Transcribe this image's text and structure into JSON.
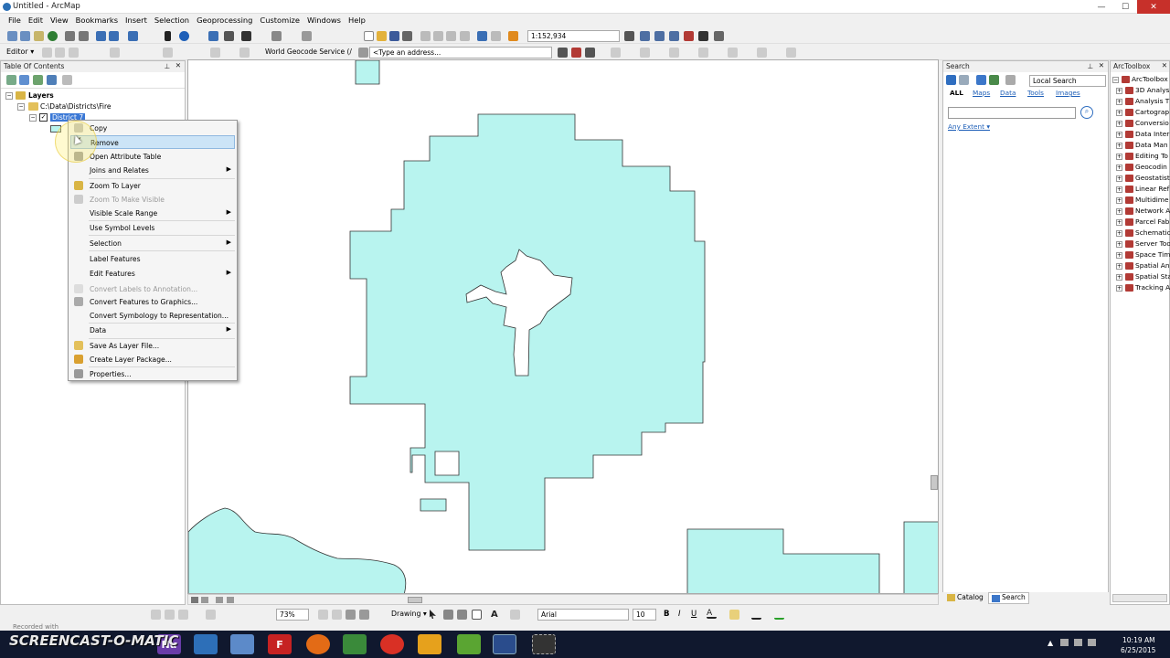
{
  "window": {
    "title": "Untitled - ArcMap",
    "minimize": "—",
    "maximize": "☐",
    "close": "✕"
  },
  "menu": [
    "File",
    "Edit",
    "View",
    "Bookmarks",
    "Insert",
    "Selection",
    "Geoprocessing",
    "Customize",
    "Windows",
    "Help"
  ],
  "toolbar": {
    "scale": "1:152,934",
    "editor_label": "Editor ▾",
    "geocode_service": "World Geocode Service (/",
    "address_placeholder": "<Type an address...",
    "font": "Arial",
    "font_size": "10",
    "drawing_label": "Drawing ▾",
    "bold": "B",
    "italic": "I",
    "underline": "U",
    "zoom_percent": "73%"
  },
  "toc": {
    "title": "Table Of Contents",
    "layers_label": "Layers",
    "folder_path": "C:\\Data\\Districts\\Fire",
    "layer_name": "District 7"
  },
  "context_menu": {
    "items": [
      {
        "label": "Copy",
        "enabled": true,
        "submenu": false,
        "icon": "copy-icon"
      },
      {
        "label": "Remove",
        "enabled": true,
        "submenu": false,
        "icon": "remove-icon",
        "highlighted": true
      },
      {
        "label": "Open Attribute Table",
        "enabled": true,
        "submenu": false,
        "icon": "table-icon"
      },
      {
        "label": "Joins and Relates",
        "enabled": true,
        "submenu": true,
        "icon": ""
      },
      {
        "label": "Zoom To Layer",
        "enabled": true,
        "submenu": false,
        "icon": "zoom-layer-icon"
      },
      {
        "label": "Zoom To Make Visible",
        "enabled": false,
        "submenu": false,
        "icon": "zoom-visible-icon"
      },
      {
        "label": "Visible Scale Range",
        "enabled": true,
        "submenu": true,
        "icon": ""
      },
      {
        "label": "Use Symbol Levels",
        "enabled": true,
        "submenu": false,
        "icon": ""
      },
      {
        "label": "Selection",
        "enabled": true,
        "submenu": true,
        "icon": ""
      },
      {
        "label": "Label Features",
        "enabled": true,
        "submenu": false,
        "icon": ""
      },
      {
        "label": "Edit Features",
        "enabled": true,
        "submenu": true,
        "icon": ""
      },
      {
        "label": "Convert Labels to Annotation...",
        "enabled": false,
        "submenu": false,
        "icon": "annotation-icon"
      },
      {
        "label": "Convert Features to Graphics...",
        "enabled": true,
        "submenu": false,
        "icon": "graphics-icon"
      },
      {
        "label": "Convert Symbology to Representation...",
        "enabled": true,
        "submenu": false,
        "icon": ""
      },
      {
        "label": "Data",
        "enabled": true,
        "submenu": true,
        "icon": ""
      },
      {
        "label": "Save As Layer File...",
        "enabled": true,
        "submenu": false,
        "icon": "layer-file-icon"
      },
      {
        "label": "Create Layer Package...",
        "enabled": true,
        "submenu": false,
        "icon": "layer-package-icon"
      },
      {
        "label": "Properties...",
        "enabled": true,
        "submenu": false,
        "icon": "properties-icon"
      }
    ]
  },
  "search": {
    "title": "Search",
    "scope": "Local Search",
    "tabs": [
      "ALL",
      "Maps",
      "Data",
      "Tools",
      "Images"
    ],
    "extent": "Any Extent ▾",
    "input_value": ""
  },
  "arctoolbox": {
    "title": "ArcToolbox",
    "root": "ArcToolbox",
    "items": [
      "3D Analys",
      "Analysis T",
      "Cartograp",
      "Conversio",
      "Data Inter",
      "Data Man",
      "Editing To",
      "Geocodin",
      "Geostatist",
      "Linear Ref",
      "Multidime",
      "Network A",
      "Parcel Fab",
      "Schematic",
      "Server Too",
      "Space Tim",
      "Spatial An",
      "Spatial Sta",
      "Tracking A"
    ]
  },
  "bottom_tabs": {
    "catalog": "Catalog",
    "search": "Search"
  },
  "taskbar": {
    "time": "10:19 AM",
    "date": "6/25/2015",
    "watermark_line1": "Recorded with",
    "watermark_line2": "SCREENCAST-O-MATIC"
  },
  "colors": {
    "polygon_fill": "#b8f4ef",
    "polygon_stroke": "#333333",
    "highlight": "#cce4f7",
    "toolbox_icon": "#b23a35"
  }
}
